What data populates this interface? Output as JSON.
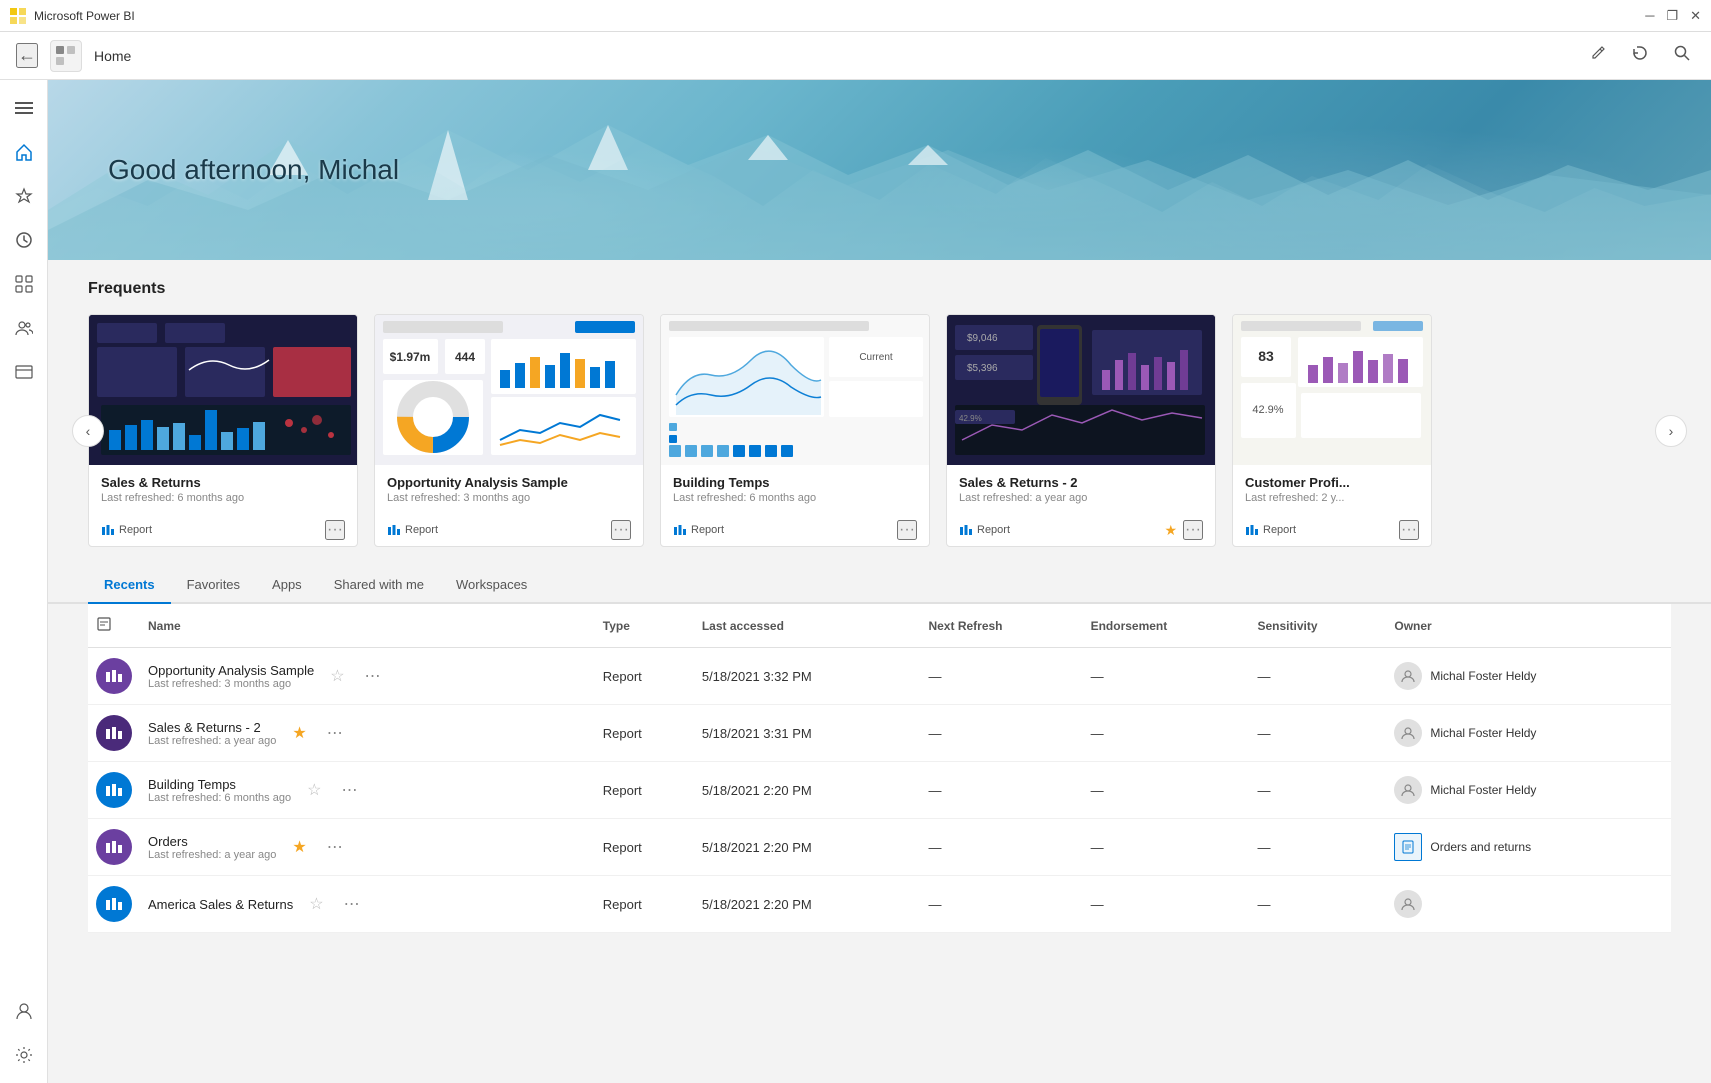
{
  "window": {
    "title": "Microsoft Power BI"
  },
  "titlebar": {
    "title": "Microsoft Power BI",
    "controls": {
      "minimize": "─",
      "restore": "❐",
      "close": "✕"
    }
  },
  "topnav": {
    "back_label": "←",
    "page_title": "Home",
    "logo_alt": "logo",
    "actions": {
      "edit": "✎",
      "refresh": "↻",
      "search": "🔍"
    }
  },
  "sidebar": {
    "items": [
      {
        "id": "menu",
        "icon": "☰",
        "label": "Menu"
      },
      {
        "id": "home",
        "icon": "⌂",
        "label": "Home"
      },
      {
        "id": "favorites",
        "icon": "☆",
        "label": "Favorites"
      },
      {
        "id": "recent",
        "icon": "🕐",
        "label": "Recent"
      },
      {
        "id": "apps",
        "icon": "⊞",
        "label": "Apps"
      },
      {
        "id": "shared",
        "icon": "👥",
        "label": "Shared with me"
      },
      {
        "id": "workspaces",
        "icon": "📋",
        "label": "Workspaces"
      },
      {
        "id": "account",
        "icon": "👤",
        "label": "Account"
      },
      {
        "id": "settings",
        "icon": "⚙",
        "label": "Settings"
      }
    ]
  },
  "hero": {
    "greeting": "Good afternoon, Michal"
  },
  "frequents": {
    "section_title": "Frequents",
    "cards": [
      {
        "id": 1,
        "title": "Sales & Returns",
        "subtitle": "Last refreshed: 6 months ago",
        "type": "Report",
        "type_icon": "chart"
      },
      {
        "id": 2,
        "title": "Opportunity Analysis Sample",
        "subtitle": "Last refreshed: 3 months ago",
        "type": "Report",
        "type_icon": "chart"
      },
      {
        "id": 3,
        "title": "Building Temps",
        "subtitle": "Last refreshed: 6 months ago",
        "type": "Report",
        "type_icon": "chart"
      },
      {
        "id": 4,
        "title": "Sales & Returns - 2",
        "subtitle": "Last refreshed: a year ago",
        "type": "Report",
        "type_icon": "chart",
        "starred": true
      },
      {
        "id": 5,
        "title": "Customer Profi...",
        "subtitle": "Last refreshed: 2 y...",
        "type": "Report",
        "type_icon": "chart"
      }
    ]
  },
  "tabs": [
    {
      "id": "recents",
      "label": "Recents",
      "active": true
    },
    {
      "id": "favorites",
      "label": "Favorites",
      "active": false
    },
    {
      "id": "apps",
      "label": "Apps",
      "active": false
    },
    {
      "id": "shared",
      "label": "Shared with me",
      "active": false
    },
    {
      "id": "workspaces",
      "label": "Workspaces",
      "active": false
    }
  ],
  "table": {
    "columns": [
      "",
      "Name",
      "Type",
      "Last accessed",
      "Next Refresh",
      "Endorsement",
      "Sensitivity",
      "Owner"
    ],
    "rows": [
      {
        "id": 1,
        "icon_color": "purple",
        "icon": "📊",
        "name": "Opportunity Analysis Sample",
        "subtitle": "Last refreshed: 3 months ago",
        "type": "Report",
        "last_accessed": "5/18/2021 3:32 PM",
        "next_refresh": "—",
        "endorsement": "—",
        "sensitivity": "—",
        "owner": "Michal Foster Heldy",
        "owner_type": "user",
        "starred": false
      },
      {
        "id": 2,
        "icon_color": "dark-purple",
        "icon": "📊",
        "name": "Sales & Returns  - 2",
        "subtitle": "Last refreshed: a year ago",
        "type": "Report",
        "last_accessed": "5/18/2021 3:31 PM",
        "next_refresh": "—",
        "endorsement": "—",
        "sensitivity": "—",
        "owner": "Michal Foster Heldy",
        "owner_type": "user",
        "starred": true
      },
      {
        "id": 3,
        "icon_color": "blue",
        "icon": "📊",
        "name": "Building Temps",
        "subtitle": "Last refreshed: 6 months ago",
        "type": "Report",
        "last_accessed": "5/18/2021 2:20 PM",
        "next_refresh": "—",
        "endorsement": "—",
        "sensitivity": "—",
        "owner": "Michal Foster Heldy",
        "owner_type": "user",
        "starred": false
      },
      {
        "id": 4,
        "icon_color": "purple",
        "icon": "📊",
        "name": "Orders",
        "subtitle": "Last refreshed: a year ago",
        "type": "Report",
        "last_accessed": "5/18/2021 2:20 PM",
        "next_refresh": "—",
        "endorsement": "—",
        "sensitivity": "—",
        "owner": "Orders and returns",
        "owner_type": "file",
        "starred": true
      },
      {
        "id": 5,
        "icon_color": "blue",
        "icon": "📊",
        "name": "America Sales & Returns",
        "subtitle": "",
        "type": "Report",
        "last_accessed": "5/18/2021 2:20 PM",
        "next_refresh": "—",
        "endorsement": "—",
        "sensitivity": "—",
        "owner": "",
        "owner_type": "user",
        "starred": false
      }
    ]
  },
  "colors": {
    "accent": "#0078d4",
    "purple": "#6b3fa0",
    "dark_purple": "#4a2a7a",
    "blue": "#0078d4"
  }
}
